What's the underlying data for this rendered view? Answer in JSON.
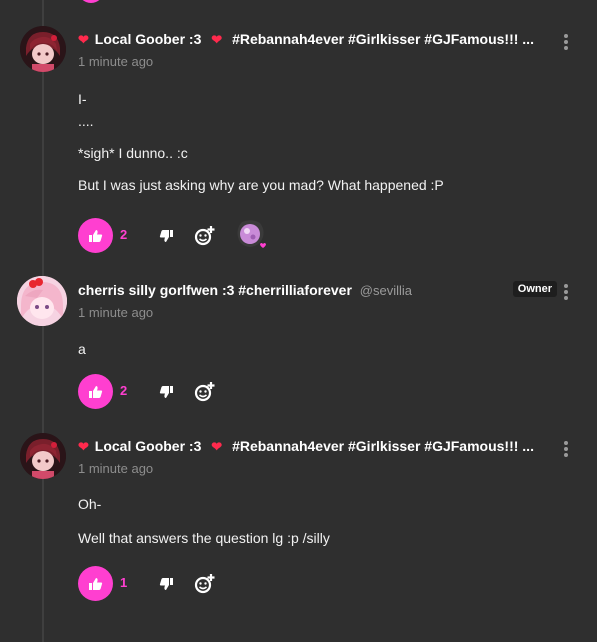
{
  "comments": [
    {
      "author": "Local Goober :3",
      "tags": "#Rebannah4ever #Girlkisser #GJFamous!!! ...",
      "time": "1 minute ago",
      "lines": [
        "I-",
        "....",
        "*sigh* I dunno.. :c",
        "But I was just asking why are you mad? What happened :P"
      ],
      "likes": "2",
      "has_reaction": true
    },
    {
      "author": "cherris silly gorlfwen :3 #cherrilliaforever",
      "handle": "@sevillia",
      "badge": "Owner",
      "time": "1 minute ago",
      "lines": [
        "a"
      ],
      "likes": "2"
    },
    {
      "author": "Local Goober :3",
      "tags": "#Rebannah4ever #Girlkisser #GJFamous!!! ...",
      "time": "1 minute ago",
      "lines": [
        "Oh-",
        "Well that answers the question lg :p /silly"
      ],
      "likes": "1"
    }
  ],
  "icons": {
    "heart": "heart-icon",
    "like": "thumbs-up-icon",
    "dislike": "thumbs-down-icon",
    "react": "add-reaction-icon",
    "more": "more-vertical-icon"
  },
  "colors": {
    "accent": "#ff3fd0",
    "background": "#2f2f2f",
    "heart": "#ff2a4d",
    "muted": "#8d8d8d"
  }
}
